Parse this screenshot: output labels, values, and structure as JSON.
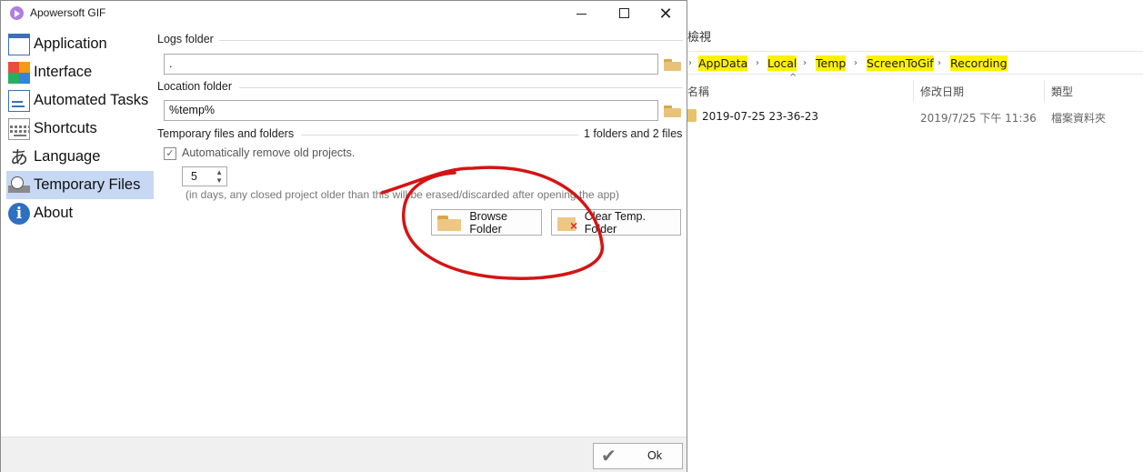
{
  "window": {
    "title": "Apowersoft GIF",
    "controls": [
      "minimize",
      "maximize",
      "close"
    ]
  },
  "sidebar": {
    "items": [
      {
        "label": "Application",
        "icon": "application-icon",
        "selected": false
      },
      {
        "label": "Interface",
        "icon": "interface-icon",
        "selected": false
      },
      {
        "label": "Automated Tasks",
        "icon": "automated-tasks-icon",
        "selected": false
      },
      {
        "label": "Shortcuts",
        "icon": "keyboard-icon",
        "selected": false
      },
      {
        "label": "Language",
        "icon": "language-icon",
        "selected": false
      },
      {
        "label": "Temporary Files",
        "icon": "temporary-files-icon",
        "selected": true
      },
      {
        "label": "About",
        "icon": "info-icon",
        "selected": false
      }
    ]
  },
  "content": {
    "logs_folder": {
      "label": "Logs folder",
      "value": "."
    },
    "location_folder": {
      "label": "Location folder",
      "value": "%temp%"
    },
    "temp_files": {
      "label": "Temporary files and folders",
      "count": "1 folders and 2 files",
      "auto_remove_label": "Automatically remove old projects.",
      "auto_remove_checked": true,
      "days": "5",
      "hint": "(in days, any closed project older than this will be erased/discarded after opening the app)"
    },
    "browse_button": "Browse Folder",
    "clear_button": "Clear Temp. Folder"
  },
  "footer": {
    "ok_label": "Ok"
  },
  "explorer": {
    "ribbon_tab": "檢視",
    "breadcrumb": [
      "AppData",
      "Local",
      "Temp",
      "ScreenToGif",
      "Recording"
    ],
    "highlight_color": "#fff200",
    "columns": [
      "名稱",
      "修改日期",
      "類型"
    ],
    "rows": [
      {
        "name": "2019-07-25 23-36-23",
        "modified": "2019/7/25 下午 11:36",
        "type": "檔案資料夾"
      }
    ]
  },
  "annotation": {
    "shape": "red-circle",
    "color": "#d41414",
    "target": "temp-folder-buttons"
  }
}
